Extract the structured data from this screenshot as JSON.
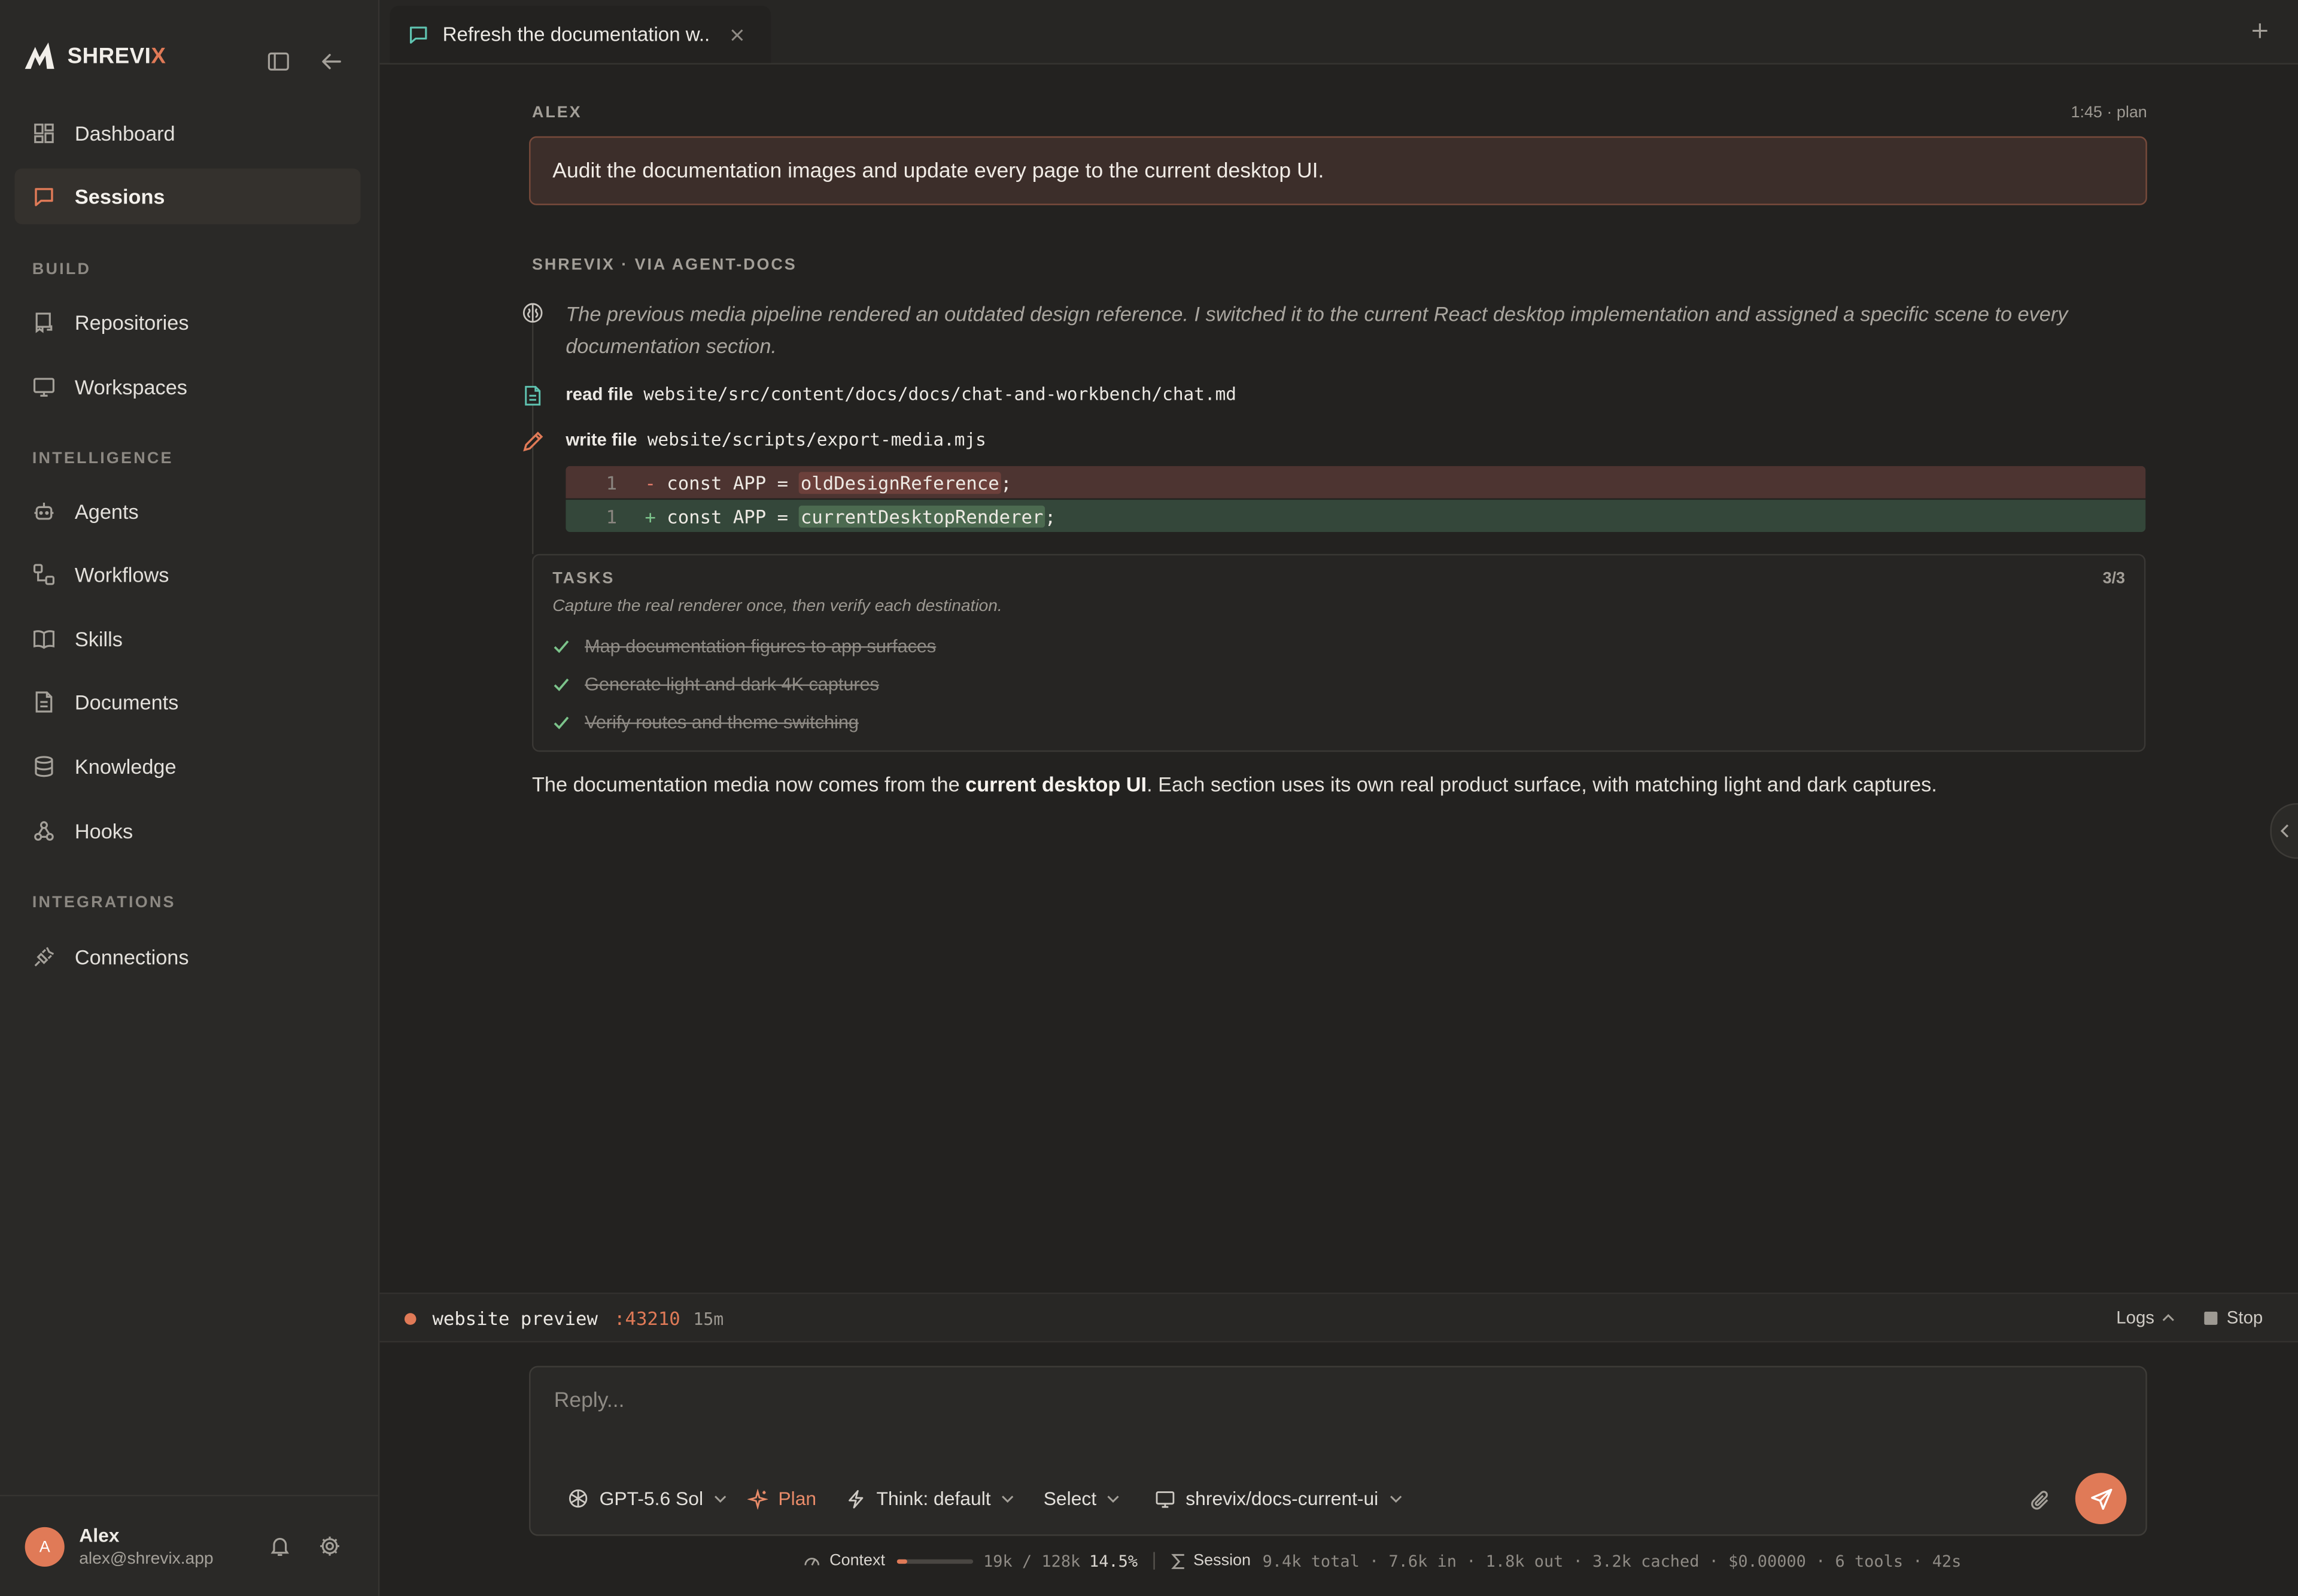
{
  "brand": {
    "name_main": "SHREVI",
    "name_accent": "X"
  },
  "sidebar": {
    "top": [
      {
        "label": "Dashboard",
        "icon": "grid-icon",
        "active": false
      },
      {
        "label": "Sessions",
        "icon": "chat-icon",
        "active": true
      }
    ],
    "sections": [
      {
        "heading": "BUILD",
        "items": [
          {
            "label": "Repositories",
            "icon": "repo-icon"
          },
          {
            "label": "Workspaces",
            "icon": "monitor-icon"
          }
        ]
      },
      {
        "heading": "INTELLIGENCE",
        "items": [
          {
            "label": "Agents",
            "icon": "bot-icon"
          },
          {
            "label": "Workflows",
            "icon": "workflow-icon"
          },
          {
            "label": "Skills",
            "icon": "book-icon"
          },
          {
            "label": "Documents",
            "icon": "document-icon"
          },
          {
            "label": "Knowledge",
            "icon": "database-icon"
          },
          {
            "label": "Hooks",
            "icon": "webhook-icon"
          }
        ]
      },
      {
        "heading": "INTEGRATIONS",
        "items": [
          {
            "label": "Connections",
            "icon": "plug-icon"
          }
        ]
      }
    ],
    "user": {
      "initial": "A",
      "name": "Alex",
      "email": "alex@shrevix.app"
    }
  },
  "tab": {
    "title": "Refresh the documentation w..."
  },
  "conversation": {
    "user_author": "ALEX",
    "user_meta": "1:45 · plan",
    "user_message": "Audit the documentation images and update every page to the current desktop UI.",
    "agent_author": "SHREVIX · VIA AGENT-DOCS",
    "thought": "The previous media pipeline rendered an outdated design reference. I switched it to the current React desktop implementation and assigned a specific scene to every documentation section.",
    "read_tool": {
      "kind": "read file",
      "path": "website/src/content/docs/docs/chat-and-workbench/chat.md"
    },
    "write_tool": {
      "kind": "write file",
      "path": "website/scripts/export-media.mjs"
    },
    "diff": {
      "del": {
        "num": "1",
        "sign": "-",
        "prefix": "const APP = ",
        "highlight": "oldDesignReference",
        "suffix": ";"
      },
      "add": {
        "num": "1",
        "sign": "+",
        "prefix": "const APP = ",
        "highlight": "currentDesktopRenderer",
        "suffix": ";"
      }
    },
    "tasks": {
      "heading": "TASKS",
      "count": "3/3",
      "description": "Capture the real renderer once, then verify each destination.",
      "items": [
        "Map documentation figures to app surfaces",
        "Generate light and dark 4K captures",
        "Verify routes and theme switching"
      ]
    },
    "summary": {
      "before": "The documentation media now comes from the ",
      "bold": "current desktop UI",
      "after": ". Each section uses its own real product surface, with matching light and dark captures."
    }
  },
  "preview": {
    "name": "website preview",
    "port": ":43210",
    "uptime": "15m",
    "logs_label": "Logs",
    "stop_label": "Stop"
  },
  "composer": {
    "placeholder": "Reply...",
    "model": "GPT-5.6 Sol",
    "mode": "Plan",
    "think": "Think: default",
    "select": "Select",
    "workspace": "shrevix/docs-current-ui"
  },
  "status": {
    "context_label": "Context",
    "context_value": "19k / 128k",
    "context_percent": "14.5%",
    "context_fraction": 0.145,
    "session_label": "Session",
    "session_value": "9.4k total · 7.6k in · 1.8k out · 3.2k cached · $0.00000 · 6 tools · 42s"
  },
  "colors": {
    "accent": "#e07a57",
    "background": "#232220",
    "sidebar": "#2a2927",
    "diff_del": "#4d3431",
    "diff_add": "#34473a"
  }
}
